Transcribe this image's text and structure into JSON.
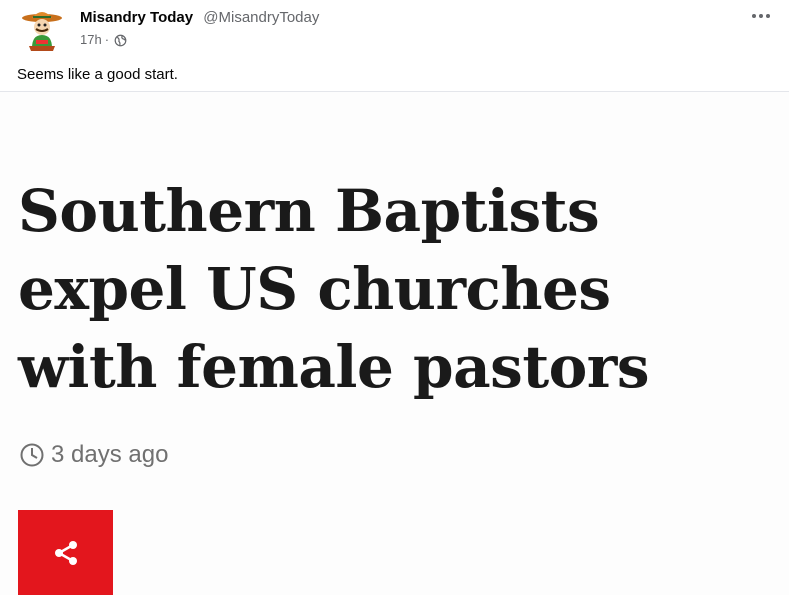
{
  "post": {
    "author_name": "Misandry Today",
    "author_handle": "@MisandryToday",
    "time": "17h",
    "separator": "·",
    "privacy_icon": "globe-icon",
    "more_icon": "more-dots-icon",
    "text": "Seems like a good start."
  },
  "article": {
    "headline_lines": [
      "Southern Baptists",
      "expel US churches",
      "with female pastors"
    ],
    "timestamp": "3 days ago",
    "clock_icon": "clock-icon",
    "share_icon": "share-icon",
    "share_color": "#e3161d"
  },
  "colors": {
    "text_primary": "#050505",
    "text_secondary": "#65676b",
    "headline": "#1a1a1a",
    "timestamp": "#707070"
  }
}
